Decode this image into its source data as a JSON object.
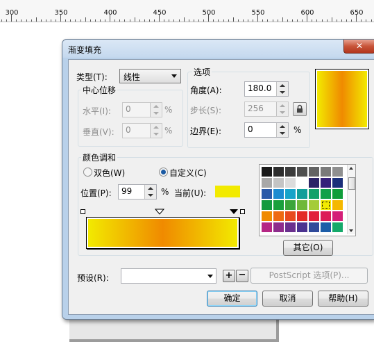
{
  "ruler": {
    "labels": [
      "300",
      "350",
      "400",
      "450",
      "500",
      "550",
      "600",
      "650"
    ]
  },
  "dialog": {
    "title": "渐变填充",
    "close_symbol": "✕",
    "type_label": "类型(T):",
    "type_value": "线性",
    "center_group": {
      "title": "中心位移",
      "horizontal_label": "水平(I):",
      "horizontal_value": "0",
      "vertical_label": "垂直(V):",
      "vertical_value": "0",
      "unit": "%"
    },
    "options_group": {
      "title": "选项",
      "angle_label": "角度(A):",
      "angle_value": "180.0",
      "steps_label": "步长(S):",
      "steps_value": "256",
      "edge_label": "边界(E):",
      "edge_value": "0",
      "unit": "%"
    },
    "blend_group": {
      "title": "颜色调和",
      "two_color_label": "双色(W)",
      "custom_label": "自定义(C)",
      "selected": "custom",
      "position_label": "位置(P):",
      "position_value": "99",
      "unit": "%",
      "current_label": "当前(U):",
      "current_color": "#f2ea00",
      "other_button": "其它(O)",
      "palette": [
        [
          "#1a1a1a",
          "#2e2e2e",
          "#3c3c3c",
          "#4f4f4f",
          "#636363",
          "#7a7a7a",
          "#8f8f8f"
        ],
        [
          "#a8a8a8",
          "#c4c4c4",
          "#dcdcdc",
          "#ffffff",
          "#2b2266",
          "#35207a",
          "#1a2f7a"
        ],
        [
          "#2a5aa8",
          "#1c8bd0",
          "#17a3c9",
          "#129e9a",
          "#12a16a",
          "#11a04a",
          "#0f9d3a"
        ],
        [
          "#129a3e",
          "#1aa03c",
          "#3ba53a",
          "#6fb83a",
          "#a4cc39",
          "#f2ea00",
          "#f5b800"
        ],
        [
          "#f08a00",
          "#ee6a12",
          "#e84a1e",
          "#e32b26",
          "#e1203c",
          "#dc1c58",
          "#d41f78"
        ],
        [
          "#b52784",
          "#8e2c8c",
          "#6a308e",
          "#4b3390",
          "#2f4a9a",
          "#1d5ea8",
          "#15a96a"
        ]
      ]
    },
    "preset_label": "预设(R):",
    "postscript_button": "PostScript 选项(P)...",
    "ok_button": "确定",
    "cancel_button": "取消",
    "help_button": "帮助(H)",
    "gradient_colors": {
      "start": "#f2ea00",
      "mid": "#f08a00",
      "end": "#f2ea00"
    }
  }
}
